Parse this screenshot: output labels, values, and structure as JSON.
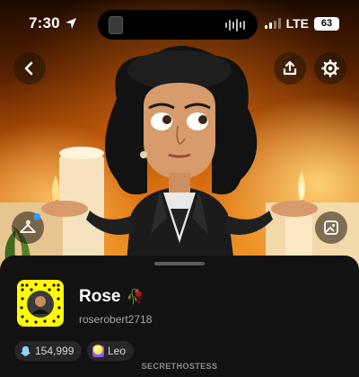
{
  "status_bar": {
    "time": "7:30",
    "network": "LTE",
    "battery": "63"
  },
  "icons": {
    "location": "location-arrow-icon",
    "back": "chevron-left-icon",
    "share": "share-upload-icon",
    "settings": "gear-icon",
    "outfit": "hanger-icon",
    "photo": "photo-frame-icon",
    "score": "snapchat-ghost-icon",
    "zodiac": "leo-zodiac-icon"
  },
  "profile": {
    "display_name": "Rose",
    "name_emoji": "🥀",
    "username": "roserobert2718",
    "snap_score": "154,999",
    "zodiac": "Leo"
  },
  "footer": {
    "caption": "SECRETHOSTESS"
  },
  "colors": {
    "snap_yellow": "#fffc00",
    "sheet_bg": "#121212",
    "chip_bg": "#262626",
    "accent_blue": "#2f9bff",
    "zodiac_purple": "#8a5cff"
  }
}
